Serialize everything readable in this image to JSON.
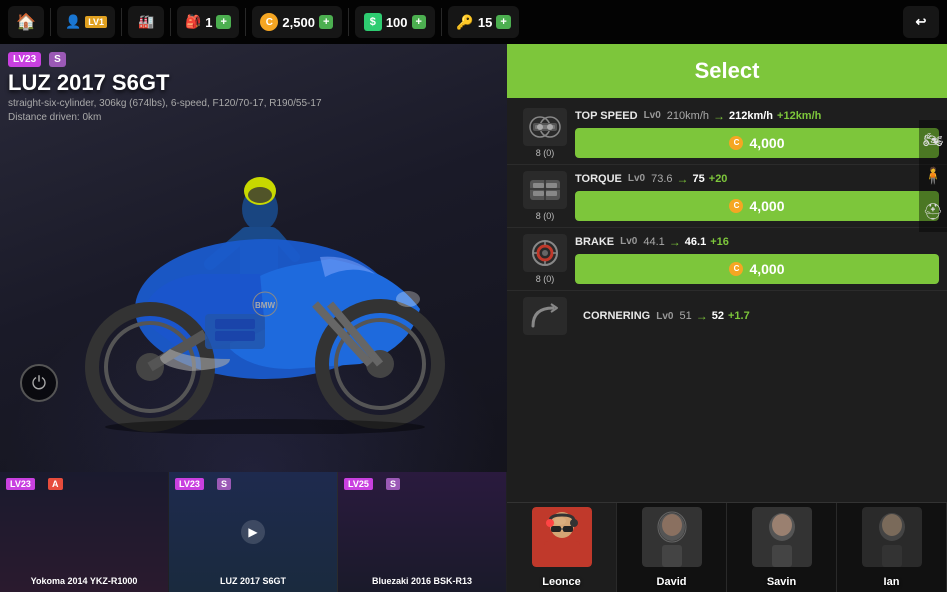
{
  "topbar": {
    "home_icon": "🏠",
    "rider_level": "LV1",
    "garage_icon": "🏠",
    "bag_count": "1",
    "plus": "+",
    "coins": "2,500",
    "dollars": "100",
    "keys": "15",
    "back_icon": "↩"
  },
  "bike": {
    "level": "LV23",
    "grade": "S",
    "name": "LUZ 2017 S6GT",
    "desc": "straight-six-cylinder, 306kg (674lbs), 6-speed, F120/70-17, R190/55-17",
    "distance": "Distance driven: 0km"
  },
  "select_button": "Select",
  "stats": [
    {
      "label": "TOP SPEED",
      "icon": "⚙",
      "lv": "Lv0",
      "from": "210km/h",
      "to": "212km/h",
      "diff": "+12km/h",
      "cost": "ⓒ 4,000",
      "cost_num": "4,000",
      "item_count": "8 (0)"
    },
    {
      "label": "TORQUE",
      "icon": "🔧",
      "lv": "Lv0",
      "from": "73.6",
      "to": "75",
      "diff": "+20",
      "cost": "ⓒ 4,000",
      "cost_num": "4,000",
      "item_count": "8 (0)"
    },
    {
      "label": "BRAKE",
      "icon": "🔴",
      "lv": "Lv0",
      "from": "44.1",
      "to": "46.1",
      "diff": "+16",
      "cost": "ⓒ 4,000",
      "cost_num": "4,000",
      "item_count": "8 (0)"
    },
    {
      "label": "CORNERING",
      "icon": "↩",
      "lv": "Lv0",
      "from": "51",
      "to": "52",
      "diff": "+1.7",
      "cost": "",
      "cost_num": "",
      "item_count": ""
    }
  ],
  "thumbnails": [
    {
      "level": "LV23",
      "grade": "A",
      "grade_class": "a",
      "name": "Yokoma 2014 YKZ-R1000",
      "active": false
    },
    {
      "level": "LV23",
      "grade": "S",
      "grade_class": "s",
      "name": "LUZ 2017 S6GT",
      "active": true
    },
    {
      "level": "LV25",
      "grade": "S",
      "grade_class": "s",
      "name": "Bluezaki 2016 BSK-R13",
      "active": false
    }
  ],
  "riders": [
    {
      "name": "Leonce",
      "active": true,
      "color": "#c0392b"
    },
    {
      "name": "David",
      "active": false,
      "color": "#555"
    },
    {
      "name": "Savin",
      "active": false,
      "color": "#555"
    },
    {
      "name": "Ian",
      "active": false,
      "color": "#555"
    }
  ]
}
